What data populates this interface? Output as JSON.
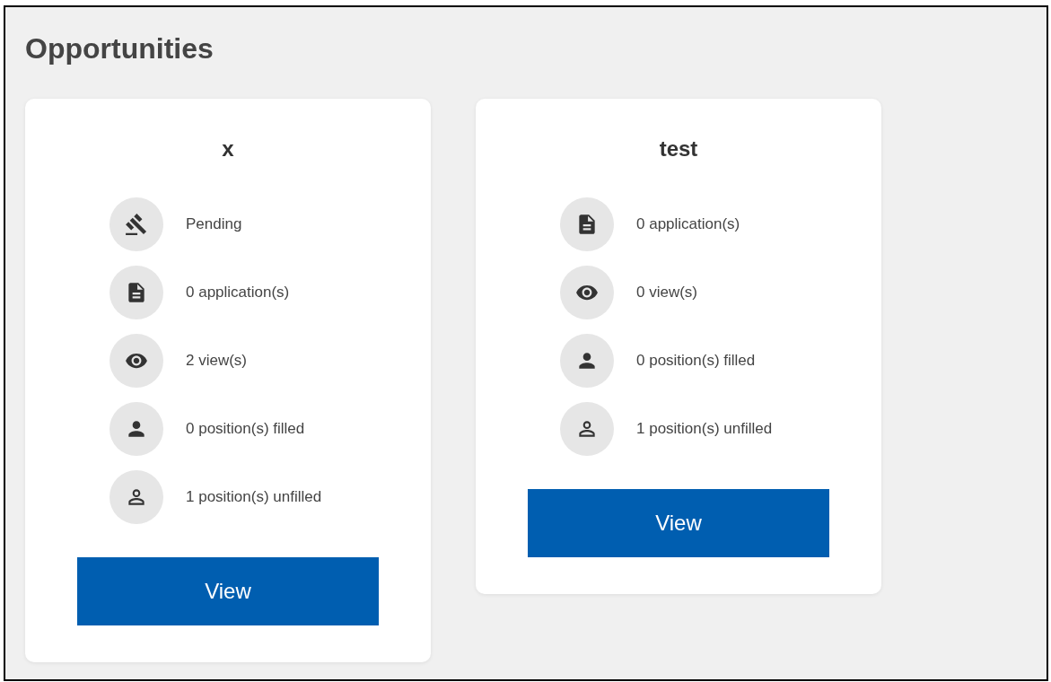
{
  "page": {
    "title": "Opportunities"
  },
  "cards": [
    {
      "title": "x",
      "stats": [
        {
          "kind": "gavel",
          "text": "Pending"
        },
        {
          "kind": "document",
          "text": "0 application(s)"
        },
        {
          "kind": "eye",
          "text": "2 view(s)"
        },
        {
          "kind": "person",
          "text": "0 position(s) filled"
        },
        {
          "kind": "person-outline",
          "text": "1 position(s) unfilled"
        }
      ],
      "button": "View"
    },
    {
      "title": "test",
      "stats": [
        {
          "kind": "document",
          "text": "0 application(s)"
        },
        {
          "kind": "eye",
          "text": "0 view(s)"
        },
        {
          "kind": "person",
          "text": "0 position(s) filled"
        },
        {
          "kind": "person-outline",
          "text": "1 position(s) unfilled"
        }
      ],
      "button": "View"
    }
  ]
}
